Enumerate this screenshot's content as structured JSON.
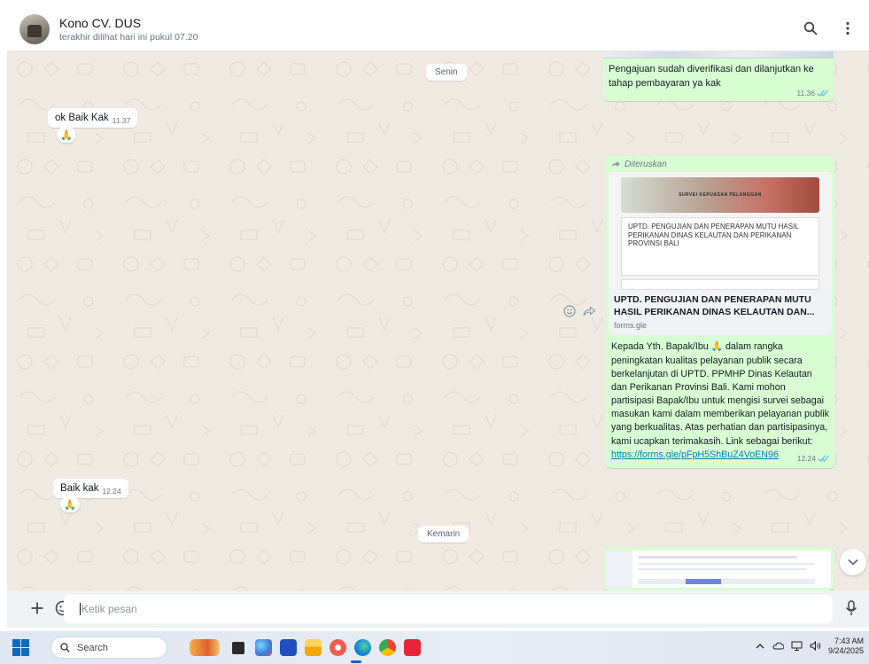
{
  "header": {
    "contact_name": "Kono CV. DUS",
    "status": "terakhir dilihat hari ini pukul 07.20",
    "icons": [
      "search-icon",
      "menu-icon"
    ]
  },
  "dates": {
    "senin": "Senin",
    "kemarin": "Kemarin"
  },
  "messages": {
    "out_verify": {
      "text": "Pengajuan sudah diverifikasi dan dilanjutkan ke tahap pembayaran ya kak",
      "time": "11.36"
    },
    "in_ok": {
      "text": "ok Baik Kak",
      "time": "11.37",
      "reaction": "🙏"
    },
    "out_forward": {
      "forward_label": "Diteruskan",
      "preview_banner": "SURVEI KEPUASAN PELANGGAN",
      "preview_card_title": "UPTD. PENGUJIAN DAN PENERAPAN MUTU HASIL PERIKANAN DINAS KELAUTAN DAN PERIKANAN PROVINSI BALI",
      "link_title": "UPTD. PENGUJIAN DAN PENERAPAN MUTU HASIL PERIKANAN DINAS KELAUTAN DAN...",
      "link_domain": "forms.gle",
      "body_before": "Kepada Yth. Bapak/Ibu 🙏 dalam rangka peningkatan kualitas pelayanan publik secara berkelanjutan di UPTD. PPMHP Dinas Kelautan dan Perikanan Provinsi Bali. Kami mohon partisipasi Bapak/Ibu untuk mengisi survei sebagai masukan kami dalam memberikan pelayanan publik yang berkualitas. Atas perhatian dan partisipasinya, kami ucapkan terimakasih. Link sebagai berikut:",
      "link_url": "https://forms.gle/pFpH5ShBuZ4VoEN96",
      "time": "12.24"
    },
    "in_baik": {
      "text": "Baik kak",
      "time": "12.24",
      "reaction": "🙏"
    }
  },
  "composer": {
    "placeholder": "Ketik pesan",
    "icons": [
      "plus-icon",
      "sticker-icon",
      "mic-icon"
    ]
  },
  "taskbar": {
    "search_label": "Search",
    "time": "7:43 AM",
    "date": "9/24/2025"
  },
  "colors": {
    "chat_bg": "#efeae2",
    "bubble_out": "#d9fdd3",
    "link": "#027eb5",
    "tick_blue": "#53bdeb"
  }
}
